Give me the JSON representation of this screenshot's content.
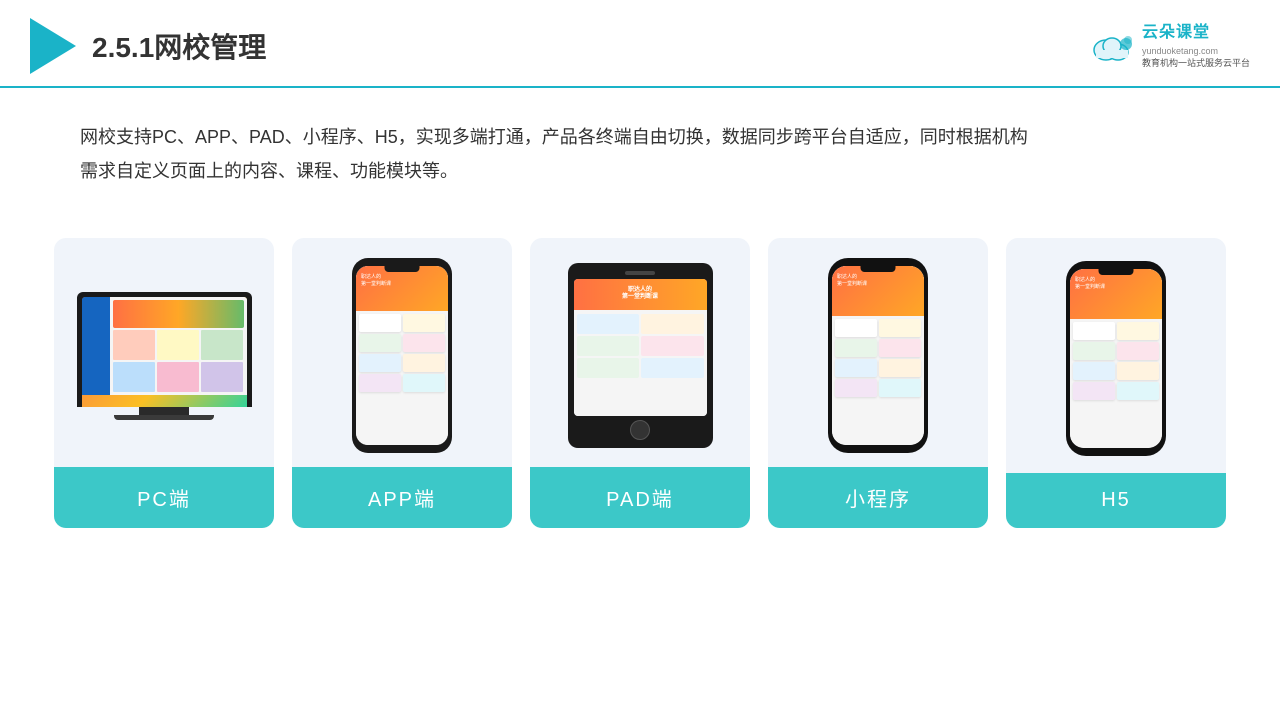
{
  "header": {
    "title": "2.5.1网校管理",
    "brand": {
      "name": "云朵课堂",
      "url": "yunduoketang.com",
      "slogan": "教育机构一站\n式服务云平台"
    }
  },
  "description": {
    "text": "网校支持PC、APP、PAD、小程序、H5，实现多端打通，产品各终端自由切换，数据同步跨平台自适应，同时根据机构\n需求自定义页面上的内容、课程、功能模块等。"
  },
  "cards": [
    {
      "id": "pc",
      "label": "PC端"
    },
    {
      "id": "app",
      "label": "APP端"
    },
    {
      "id": "pad",
      "label": "PAD端"
    },
    {
      "id": "mini",
      "label": "小程序"
    },
    {
      "id": "h5",
      "label": "H5"
    }
  ],
  "colors": {
    "accent": "#1ab3c8",
    "teal": "#3cc8c8",
    "card_bg": "#eef2fa"
  }
}
